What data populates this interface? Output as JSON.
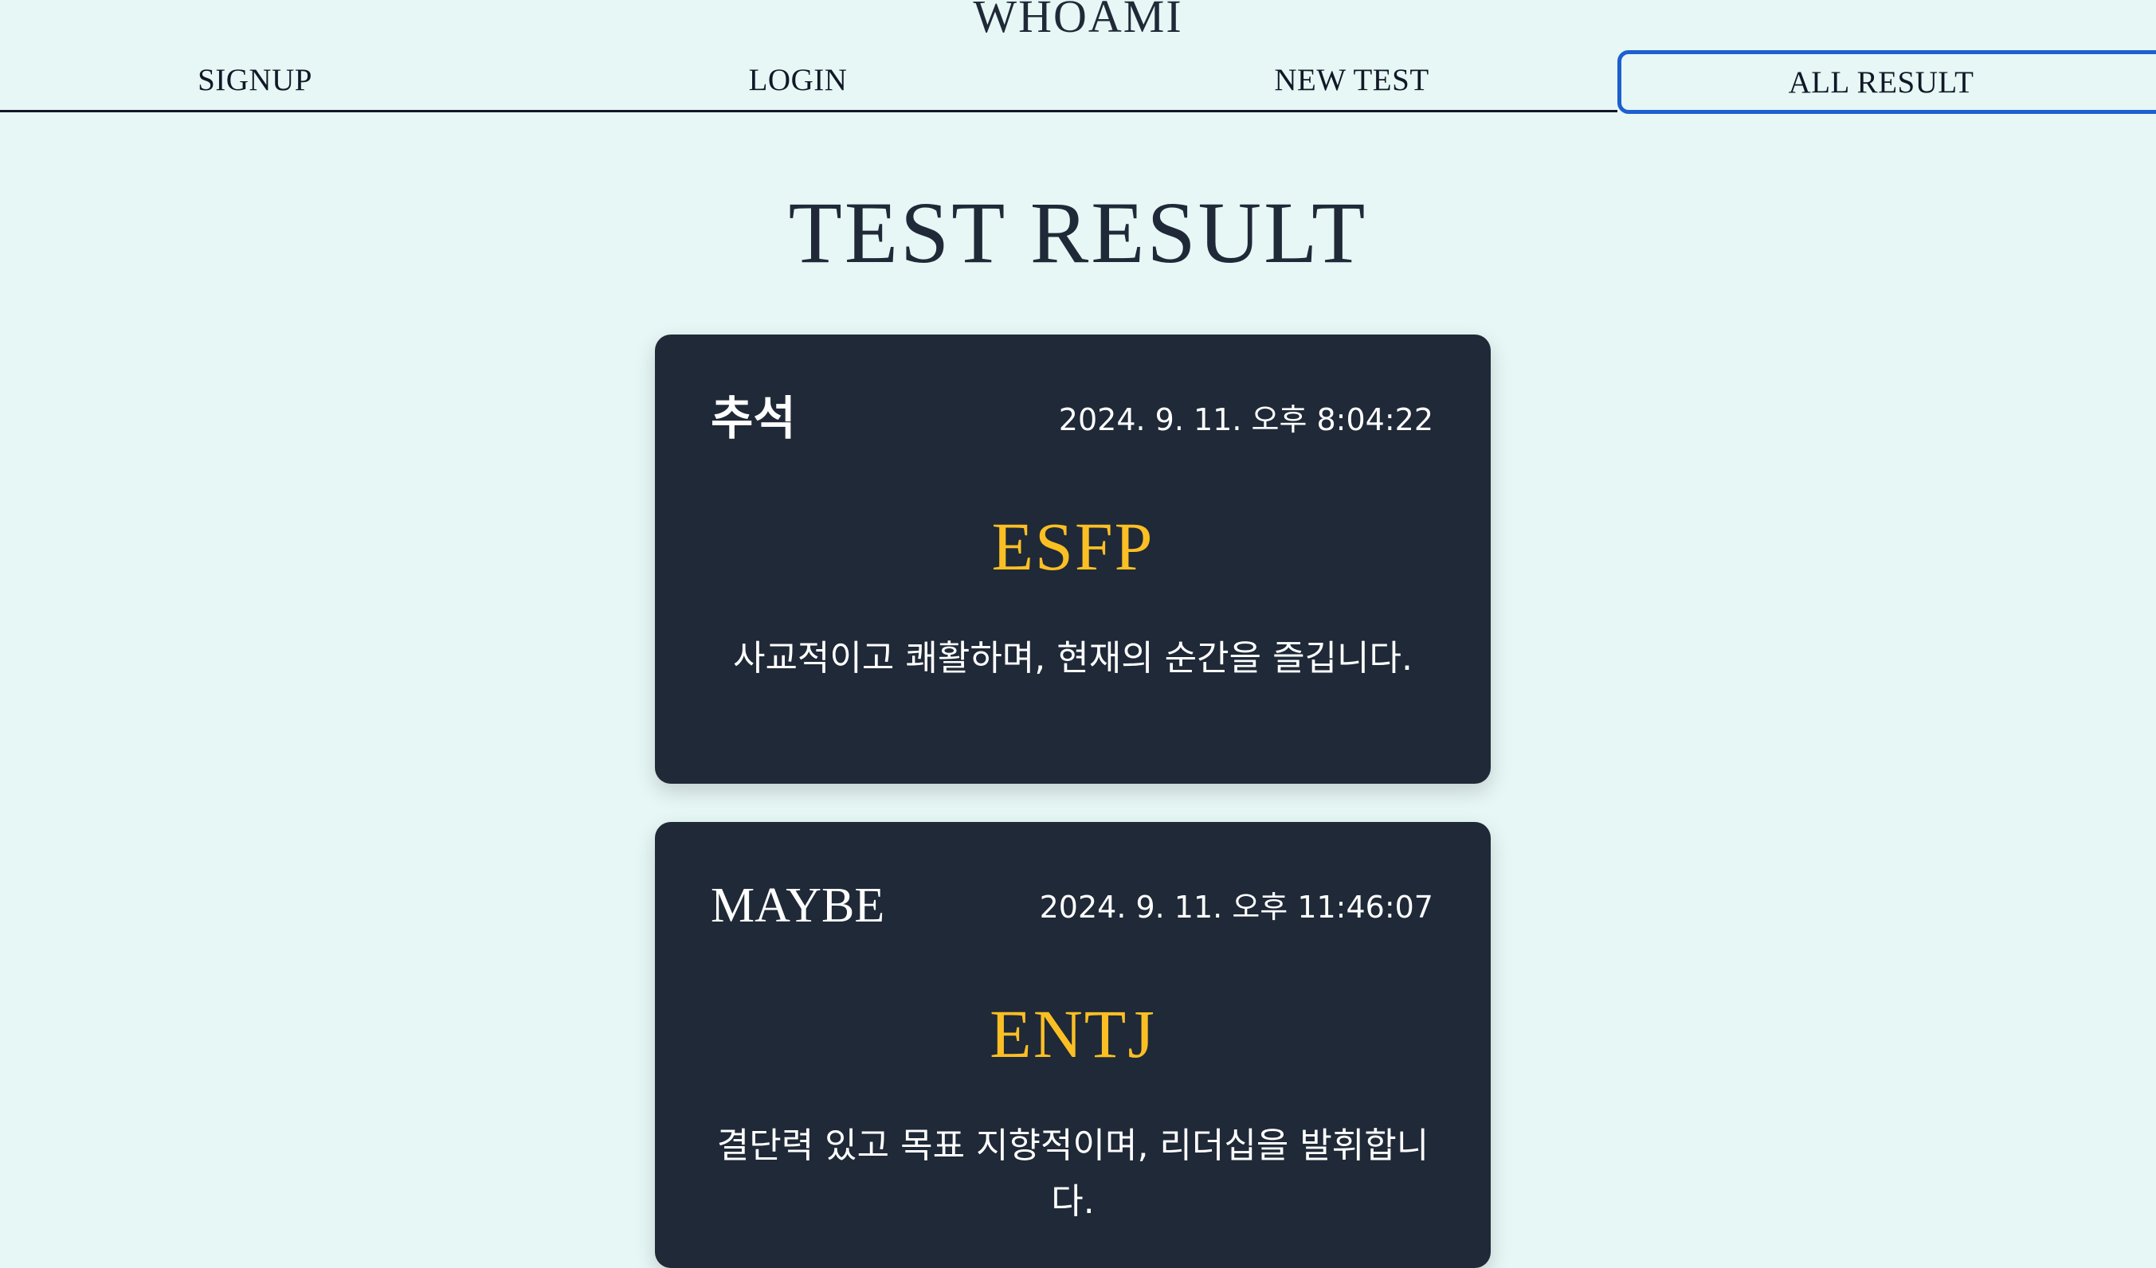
{
  "header": {
    "brand": "WHOAMI",
    "nav": [
      {
        "label": "SIGNUP"
      },
      {
        "label": "LOGIN"
      },
      {
        "label": "NEW TEST"
      },
      {
        "label": "ALL RESULT"
      }
    ]
  },
  "main": {
    "title": "TEST RESULT",
    "results": [
      {
        "name": "추석",
        "date": "2024. 9. 11. 오후 8:04:22",
        "type": "ESFP",
        "description": "사교적이고 쾌활하며, 현재의 순간을 즐깁니다."
      },
      {
        "name": "MAYBE",
        "date": "2024. 9. 11. 오후 11:46:07",
        "type": "ENTJ",
        "description": "결단력 있고 목표 지향적이며, 리더십을 발휘합니다."
      }
    ]
  },
  "colors": {
    "background": "#e6f7f5",
    "card": "#1f2937",
    "accent": "#fbbf24",
    "active_nav_border": "#1d5fd0"
  }
}
